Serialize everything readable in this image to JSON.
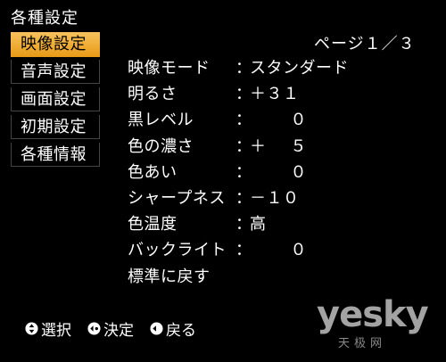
{
  "title": "各種設定",
  "page_indicator": "ページ１／３",
  "menu": [
    {
      "label": "映像設定",
      "selected": true
    },
    {
      "label": "音声設定",
      "selected": false
    },
    {
      "label": "画面設定",
      "selected": false
    },
    {
      "label": "初期設定",
      "selected": false
    },
    {
      "label": "各種情報",
      "selected": false
    }
  ],
  "settings": [
    {
      "label": "映像モード",
      "colon": "：",
      "value": "スタンダード"
    },
    {
      "label": "明るさ",
      "colon": "：",
      "value": "＋３１"
    },
    {
      "label": "黒レベル",
      "colon": "：",
      "value": "０"
    },
    {
      "label": "色の濃さ",
      "colon": "：",
      "sign": "＋",
      "value": "５"
    },
    {
      "label": "色あい",
      "colon": "：",
      "value": "０"
    },
    {
      "label": "シャープネス",
      "colon": "：",
      "value": "－１０"
    },
    {
      "label": "色温度",
      "colon": "：",
      "value": "高"
    },
    {
      "label": "バックライト",
      "colon": "：",
      "value": "０"
    },
    {
      "label": "標準に戻す"
    }
  ],
  "footer": {
    "select_label": "選択",
    "confirm_label": "決定",
    "back_label": "戻る"
  },
  "watermark": {
    "main": "yesky",
    "sub": "天极网"
  },
  "colors": {
    "background": "#000000",
    "text": "#ffffff",
    "highlight": "#f0aa30",
    "watermark": "#b5b5b5"
  },
  "icons": {
    "select": "up-down-arrows-circle-icon",
    "confirm": "enter-circle-icon",
    "back": "return-circle-icon"
  }
}
